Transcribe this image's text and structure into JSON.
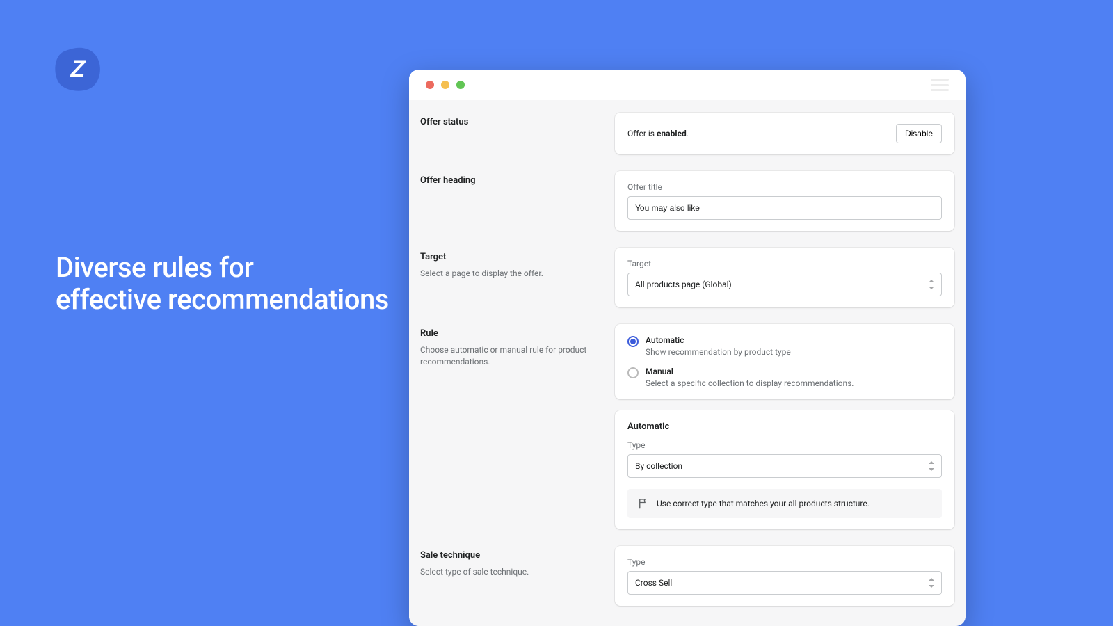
{
  "hero": {
    "line1": "Diverse rules for",
    "line2": "effective recommendations"
  },
  "sections": {
    "offer_status": {
      "title": "Offer status",
      "status_prefix": "Offer is ",
      "status_word": "enabled",
      "status_suffix": ".",
      "disable_btn": "Disable"
    },
    "offer_heading": {
      "title": "Offer heading",
      "field_label": "Offer title",
      "value": "You may also like"
    },
    "target": {
      "title": "Target",
      "desc": "Select a page to display the offer.",
      "field_label": "Target",
      "value": "All products page (Global)"
    },
    "rule": {
      "title": "Rule",
      "desc": "Choose automatic or manual rule for product recommendations.",
      "automatic": {
        "label": "Automatic",
        "desc": "Show recommendation by product type"
      },
      "manual": {
        "label": "Manual",
        "desc": "Select a specific collection to display recommendations."
      }
    },
    "automatic": {
      "heading": "Automatic",
      "field_label": "Type",
      "value": "By collection",
      "tip": "Use correct type that matches your all products structure."
    },
    "sale_technique": {
      "title": "Sale technique",
      "desc": "Select type of sale technique.",
      "field_label": "Type",
      "value": "Cross Sell"
    }
  }
}
